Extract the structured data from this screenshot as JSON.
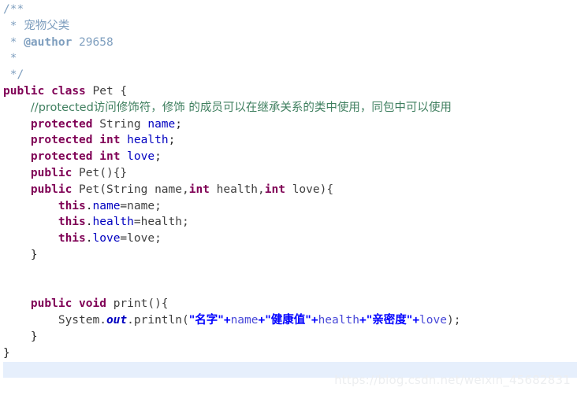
{
  "editor": {
    "file_name": "Pet.java",
    "background_color": "#ffffff",
    "current_line_highlight_color": "#e6effc",
    "current_line_index": 22
  },
  "theme": {
    "keyword_color": "#7f0055",
    "string_color": "#0000ff",
    "field_color": "#0000c0",
    "comment_color": "#3f7f5f",
    "javadoc_color": "#7f9fbf",
    "plain_color": "#262626"
  },
  "code": {
    "l0_doc_open": "/**",
    "l1_doc_star": " * ",
    "l1_doc_text": "宠物父类",
    "l2_doc_star": " * ",
    "l2_doc_tag": "@author",
    "l2_doc_author": " 29658",
    "l3_doc_star": " *",
    "l4_doc_close": " */",
    "l5_public": "public",
    "l5_sp1": " ",
    "l5_class": "class",
    "l5_rest": " Pet {",
    "l6_indent": "    ",
    "l6_comment": "//protected访问修饰符，修饰 的成员可以在继承关系的类中使用，同包中可以使用",
    "l7_indent": "    ",
    "l7_protected": "protected",
    "l7_type": " String ",
    "l7_field": "name",
    "l7_semi": ";",
    "l8_indent": "    ",
    "l8_protected": "protected",
    "l8_sp": " ",
    "l8_int": "int",
    "l8_sp2": " ",
    "l8_field": "health",
    "l8_semi": ";",
    "l9_indent": "    ",
    "l9_protected": "protected",
    "l9_sp": " ",
    "l9_int": "int",
    "l9_sp2": " ",
    "l9_field": "love",
    "l9_semi": ";",
    "l10_indent": "    ",
    "l10_public": "public",
    "l10_rest": " Pet(){}",
    "l11_indent": "    ",
    "l11_public": "public",
    "l11_sig_a": " Pet(String name,",
    "l11_int1": "int",
    "l11_sig_b": " health,",
    "l11_int2": "int",
    "l11_sig_c": " love){",
    "l12_indent": "        ",
    "l12_this": "this",
    "l12_dot": ".",
    "l12_field": "name",
    "l12_assign": "=name;",
    "l13_indent": "        ",
    "l13_this": "this",
    "l13_dot": ".",
    "l13_field": "health",
    "l13_assign": "=health;",
    "l14_indent": "        ",
    "l14_this": "this",
    "l14_dot": ".",
    "l14_field": "love",
    "l14_assign": "=love;",
    "l15_close": "    }",
    "l16_blank": "",
    "l17_blank": "",
    "l18_indent": "    ",
    "l18_public": "public",
    "l18_sp": " ",
    "l18_void": "void",
    "l18_rest": " print(){",
    "l19_indent": "        ",
    "l19_system": "System.",
    "l19_out": "out",
    "l19_println": ".println(",
    "l19_str1": "\"名字\"",
    "l19_plus1": "+",
    "l19_var1": "name",
    "l19_plus2": "+",
    "l19_str2": "\"健康值\"",
    "l19_plus3": "+",
    "l19_var2": "health",
    "l19_plus4": "+",
    "l19_str3": "\"亲密度\"",
    "l19_plus5": "+",
    "l19_var3": "love",
    "l19_tail": ");",
    "l20_close": "    }",
    "l21_close": "}",
    "l22_current": ""
  },
  "watermark": {
    "text": "https://blog.csdn.net/weixin_45682831"
  }
}
